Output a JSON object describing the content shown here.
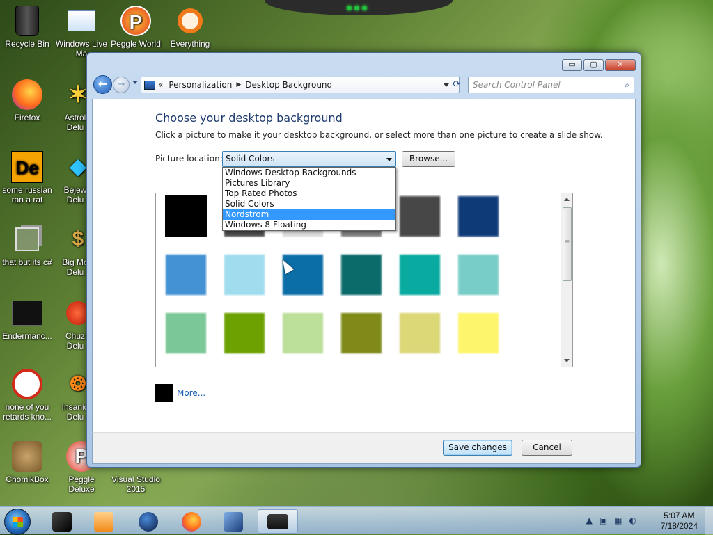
{
  "desktop": {
    "icons": [
      {
        "label": "Recycle Bin"
      },
      {
        "label": "Windows Live Ma"
      },
      {
        "label": "Peggle World"
      },
      {
        "label": "Everything"
      },
      {
        "label": "Firefox"
      },
      {
        "label": "Astrol Delu"
      },
      {
        "label": "some russian ran a rat"
      },
      {
        "label": "Bejew Delu"
      },
      {
        "label": "that but its c#"
      },
      {
        "label": "Big Mo Delu"
      },
      {
        "label": "Endermanc..."
      },
      {
        "label": "Chuz Delu"
      },
      {
        "label": "none of you retards kno..."
      },
      {
        "label": "Insaniq Delu"
      },
      {
        "label": "ChomikBox"
      },
      {
        "label": "Peggle Deluxe"
      },
      {
        "label": "Visual Studio 2015"
      }
    ]
  },
  "window": {
    "controls": {
      "minimize": "▭",
      "maximize": "▢",
      "close": "✕"
    },
    "nav": {
      "back": "←",
      "forward": "→",
      "refresh": "⟳"
    },
    "breadcrumb": {
      "root": "«",
      "item1": "Personalization",
      "item2": "Desktop Background"
    },
    "search_placeholder": "Search Control Panel",
    "search_icon": "⌕"
  },
  "main": {
    "title": "Choose your desktop background",
    "description": "Click a picture to make it your desktop background, or select more than one picture to create a slide show.",
    "picture_location_label": "Picture location:",
    "picture_location_value": "Solid Colors",
    "browse_label": "Browse...",
    "dropdown_options": [
      "Windows Desktop Backgrounds",
      "Pictures Library",
      "Top Rated Photos",
      "Solid Colors",
      "Nordstrom",
      "Windows 8 Floating"
    ],
    "dropdown_selected_index": 4,
    "swatch_rows": [
      [
        "#000000",
        "#4a4a4a",
        "#d9d9d9",
        "#7a7a7a",
        "#474747",
        "#0f3a78"
      ],
      [
        "#4491d4",
        "#9fdcee",
        "#0b6ea6",
        "#0b6b6a",
        "#09aba0",
        "#79cdc8"
      ],
      [
        "#7cc797",
        "#6ba100",
        "#bcdf9a",
        "#7f8a19",
        "#dcd878",
        "#fdf56c"
      ]
    ],
    "more_label": "More...",
    "more_color": "#000000"
  },
  "footer": {
    "save_label": "Save changes",
    "cancel_label": "Cancel"
  },
  "taskbar": {
    "clock_time": "5:07 AM",
    "clock_date": "7/18/2024"
  }
}
